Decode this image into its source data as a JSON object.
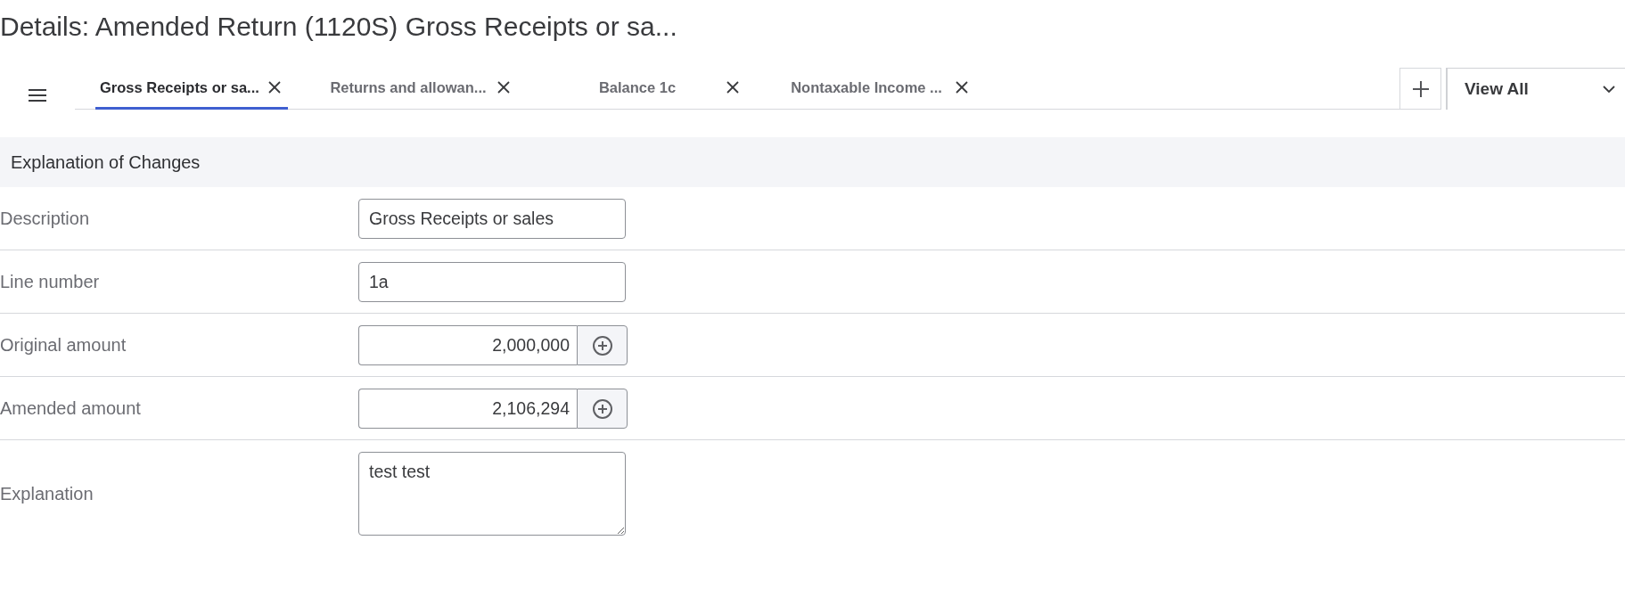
{
  "page_title": "Details: Amended Return (1120S) Gross Receipts or sa...",
  "tabs": [
    {
      "label": "Gross Receipts or sa...",
      "selected": true
    },
    {
      "label": "Returns and allowan...",
      "selected": false
    },
    {
      "label": "Balance 1c",
      "selected": false
    },
    {
      "label": "Nontaxable Income ...",
      "selected": false
    }
  ],
  "view_menu": {
    "value": "View All"
  },
  "section": {
    "title": "Explanation of Changes",
    "fields": [
      {
        "label": "Description",
        "kind": "text",
        "value": "Gross Receipts or sales"
      },
      {
        "label": "Line number",
        "kind": "text",
        "value": "1a"
      },
      {
        "label": "Original amount",
        "kind": "amount",
        "value": "2,000,000"
      },
      {
        "label": "Amended amount",
        "kind": "amount",
        "value": "2,106,294"
      },
      {
        "label": "Explanation",
        "kind": "textarea",
        "value": "test test"
      }
    ]
  }
}
